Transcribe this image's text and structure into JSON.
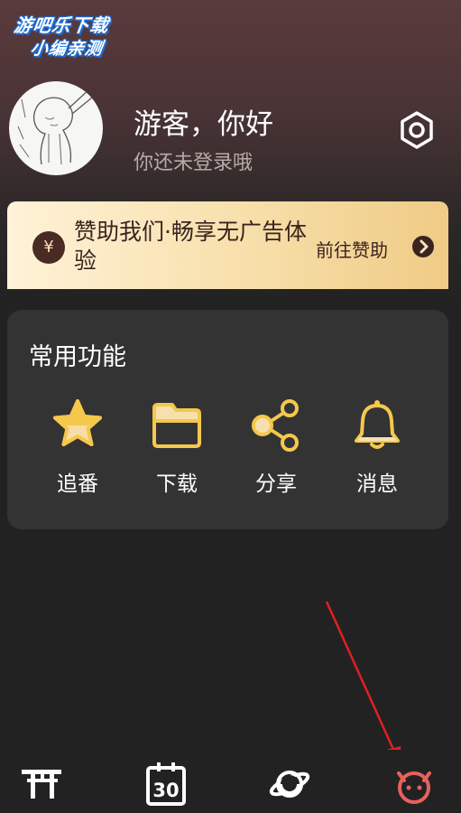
{
  "watermark": {
    "line1": "游吧乐下载",
    "line2": "小编亲测"
  },
  "profile": {
    "greeting": "游客，你好",
    "subtitle": "你还未登录哦"
  },
  "sponsor": {
    "coin_symbol": "¥",
    "text": "赞助我们·畅享无广告体验",
    "action": "前往赞助"
  },
  "functions": {
    "title": "常用功能",
    "items": [
      {
        "label": "追番",
        "icon": "star-icon"
      },
      {
        "label": "下载",
        "icon": "folder-icon"
      },
      {
        "label": "分享",
        "icon": "share-icon"
      },
      {
        "label": "消息",
        "icon": "bell-icon"
      }
    ]
  },
  "bottom_nav": [
    {
      "icon": "torii-gate-icon",
      "label": ""
    },
    {
      "icon": "calendar-30-icon",
      "label": "30"
    },
    {
      "icon": "planet-icon",
      "label": ""
    },
    {
      "icon": "profile-face-icon",
      "label": ""
    }
  ],
  "colors": {
    "accent": "#f5c84c",
    "active_nav": "#e8615d",
    "annotation_arrow": "#e02020",
    "card_bg": "#333333",
    "page_bg": "#222222"
  }
}
